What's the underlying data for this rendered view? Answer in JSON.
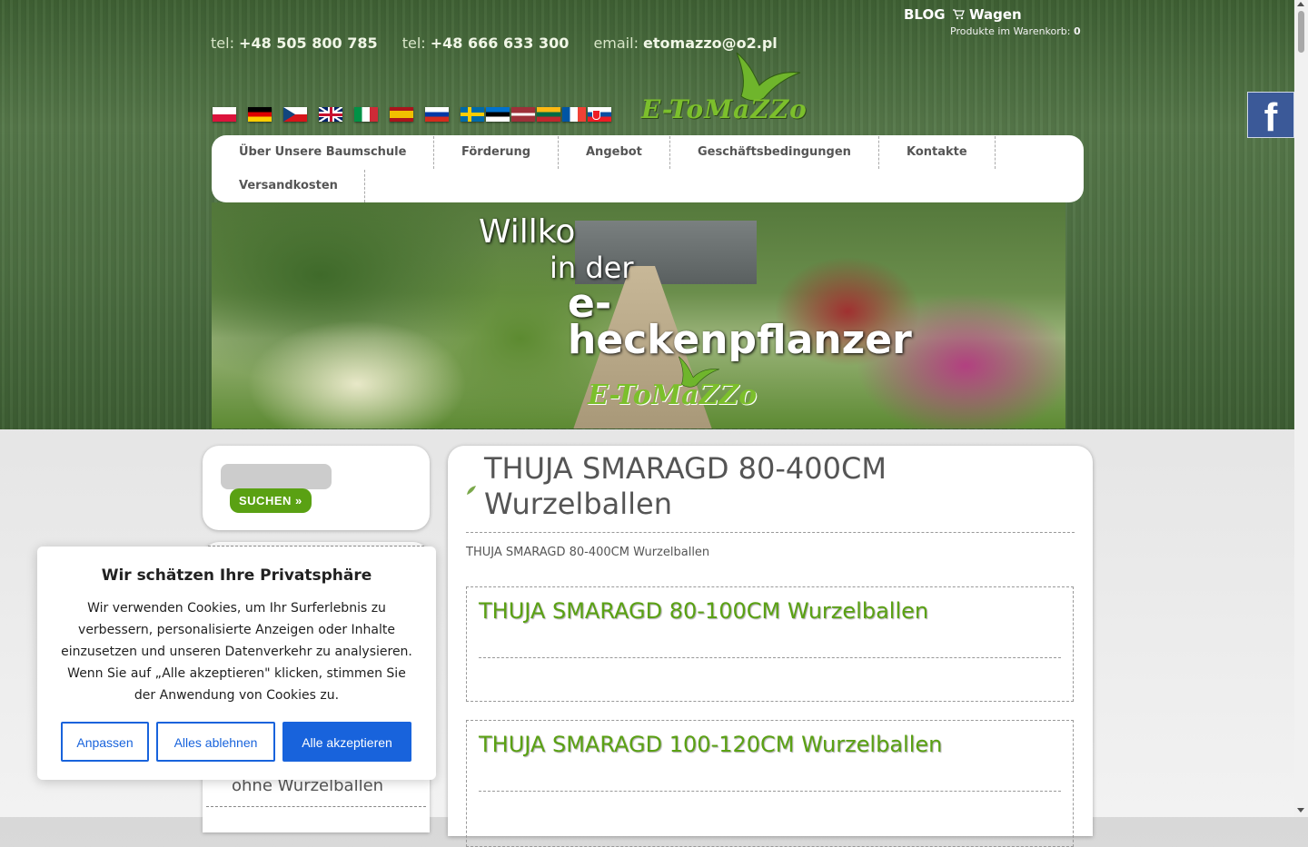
{
  "header": {
    "contacts": [
      {
        "label": "tel:",
        "value": "+48 505 800 785"
      },
      {
        "label": "tel:",
        "value": "+48 666 633 300"
      },
      {
        "label": "email:",
        "value": "etomazzo@o2.pl"
      }
    ],
    "blog": "BLOG",
    "cart_label": "Wagen",
    "cart_count_label": "Produkte im Warenkorb:",
    "cart_count": "0",
    "logo_text": "E-ToMaZZo",
    "facebook": "f"
  },
  "flags": [
    "pl",
    "de",
    "cz",
    "gb",
    "it",
    "es",
    "ru",
    "se",
    "ee",
    "lv",
    "lt",
    "fr",
    "sk"
  ],
  "nav": {
    "items": [
      "Über Unsere Baumschule",
      "Förderung",
      "Angebot",
      "Geschäftsbedingungen",
      "Kontakte",
      "Versandkosten"
    ]
  },
  "banner": {
    "line1": "Willko",
    "line2": "in der",
    "line3a": "e-",
    "line3b": "heckenpflanzer",
    "logo": "E-ToMaZZo"
  },
  "sidebar": {
    "search_button": "SUCHEN »",
    "visible_item": "ohne Wurzelballen"
  },
  "main": {
    "title": "THUJA SMARAGD 80-400CM Wurzelballen",
    "breadcrumb": "THUJA SMARAGD 80-400CM Wurzelballen",
    "products": [
      {
        "name": "THUJA SMARAGD 80-100CM Wurzelballen"
      },
      {
        "name": "THUJA SMARAGD 100-120CM Wurzelballen"
      }
    ]
  },
  "cookie": {
    "title": "Wir schätzen Ihre Privatsphäre",
    "text": "Wir verwenden Cookies, um Ihr Surferlebnis zu verbessern, personalisierte Anzeigen oder Inhalte einzusetzen und unseren Datenverkehr zu analysieren. Wenn Sie auf „Alle akzeptieren\" klicken, stimmen Sie der Anwendung von Cookies zu.",
    "btn_customize": "Anpassen",
    "btn_reject": "Alles ablehnen",
    "btn_accept": "Alle akzeptieren"
  }
}
